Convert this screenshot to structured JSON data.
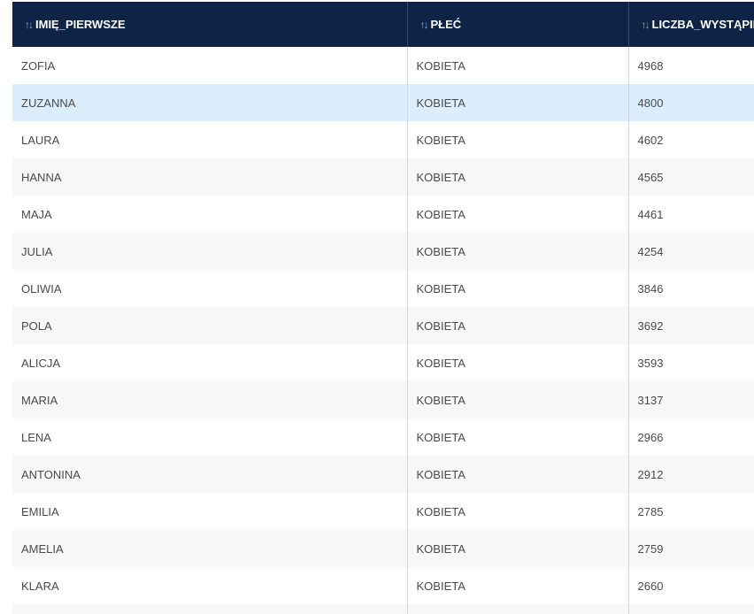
{
  "table": {
    "columns": [
      {
        "label": "IMIĘ_PIERWSZE",
        "icon": "sort-icon"
      },
      {
        "label": "PŁEĆ",
        "icon": "sort-icon"
      },
      {
        "label": "LICZBA_WYSTĄPIEŃ",
        "icon": "sort-icon"
      }
    ],
    "sort_glyph": "↑↓",
    "selected_row_index": 1,
    "rows": [
      {
        "name": "ZOFIA",
        "gender": "KOBIETA",
        "count": "4968"
      },
      {
        "name": "ZUZANNA",
        "gender": "KOBIETA",
        "count": "4800"
      },
      {
        "name": "LAURA",
        "gender": "KOBIETA",
        "count": "4602"
      },
      {
        "name": "HANNA",
        "gender": "KOBIETA",
        "count": "4565"
      },
      {
        "name": "MAJA",
        "gender": "KOBIETA",
        "count": "4461"
      },
      {
        "name": "JULIA",
        "gender": "KOBIETA",
        "count": "4254"
      },
      {
        "name": "OLIWIA",
        "gender": "KOBIETA",
        "count": "3846"
      },
      {
        "name": "POLA",
        "gender": "KOBIETA",
        "count": "3692"
      },
      {
        "name": "ALICJA",
        "gender": "KOBIETA",
        "count": "3593"
      },
      {
        "name": "MARIA",
        "gender": "KOBIETA",
        "count": "3137"
      },
      {
        "name": "LENA",
        "gender": "KOBIETA",
        "count": "2966"
      },
      {
        "name": "ANTONINA",
        "gender": "KOBIETA",
        "count": "2912"
      },
      {
        "name": "EMILIA",
        "gender": "KOBIETA",
        "count": "2785"
      },
      {
        "name": "AMELIA",
        "gender": "KOBIETA",
        "count": "2759"
      },
      {
        "name": "KLARA",
        "gender": "KOBIETA",
        "count": "2660"
      },
      {
        "name": "",
        "gender": "",
        "count": ""
      }
    ]
  }
}
